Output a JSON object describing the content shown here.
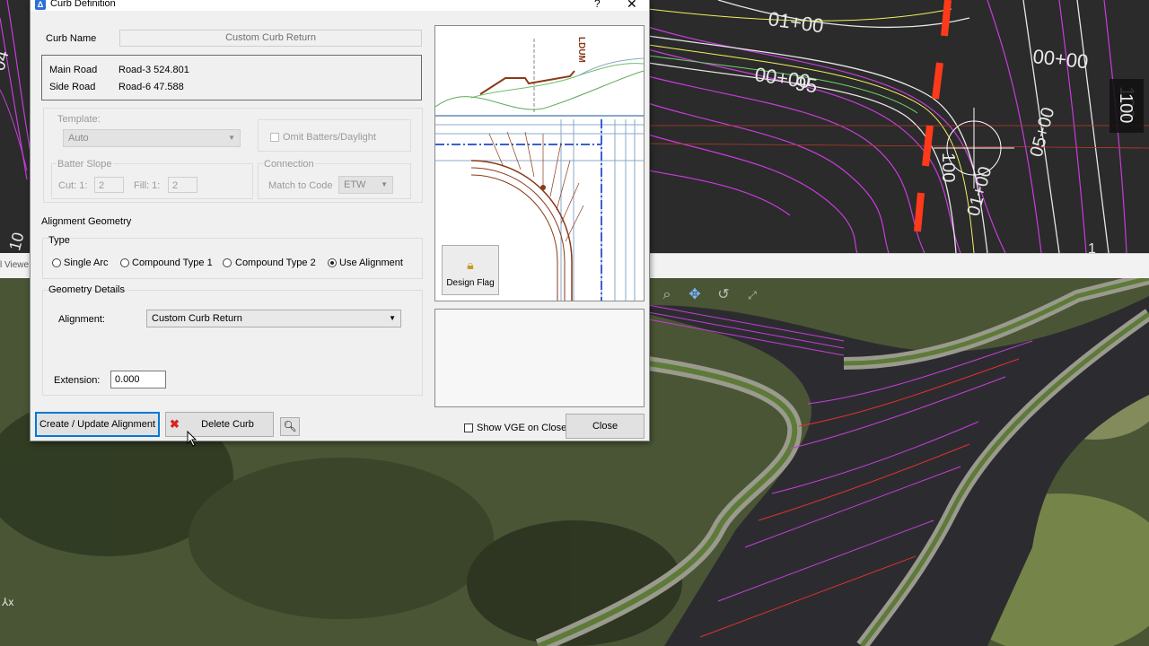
{
  "dialog": {
    "title": "Curb Definition",
    "help": "?",
    "close_glyph": "✕",
    "curb_name_label": "Curb Name",
    "curb_name_value": "Custom Curb Return",
    "main_road_label": "Main Road",
    "main_road_value": "Road-3  524.801",
    "side_road_label": "Side Road",
    "side_road_value": "Road-6  47.588",
    "template_label": "Template:",
    "template_value": "Auto",
    "omit_label": "Omit Batters/Daylight",
    "batter_label": "Batter Slope",
    "cut_label": "Cut: 1:",
    "cut_value": "2",
    "fill_label": "Fill:  1:",
    "fill_value": "2",
    "connection_label": "Connection",
    "match_label": "Match to Code",
    "match_value": "ETW",
    "alignment_geometry": "Alignment Geometry",
    "type_label": "Type",
    "types": [
      "Single Arc",
      "Compound Type 1",
      "Compound Type 2",
      "Use Alignment"
    ],
    "selected_type": "Use Alignment",
    "geometry_details": "Geometry Details",
    "alignment_label": "Alignment:",
    "alignment_value": "Custom Curb Return",
    "extension_label": "Extension:",
    "extension_value": "0.000",
    "create_button": "Create / Update Alignment",
    "delete_button": "Delete Curb",
    "show_vge_label": "Show VGE on Close",
    "close_button": "Close",
    "design_flag": "Design Flag",
    "preview_label": "LDUM"
  },
  "background": {
    "plan_labels": [
      "01+00",
      "00+00",
      "95",
      "00+00",
      "100",
      "05+00",
      "01+00",
      "100",
      "04",
      "1",
      "10"
    ],
    "viewer_tab": "l Viewe"
  },
  "colors": {
    "dialog_bg": "#f0f0f0",
    "accent": "#0078d7",
    "cad_magenta": "#c83cdc",
    "cad_red": "#ff3a1a"
  }
}
